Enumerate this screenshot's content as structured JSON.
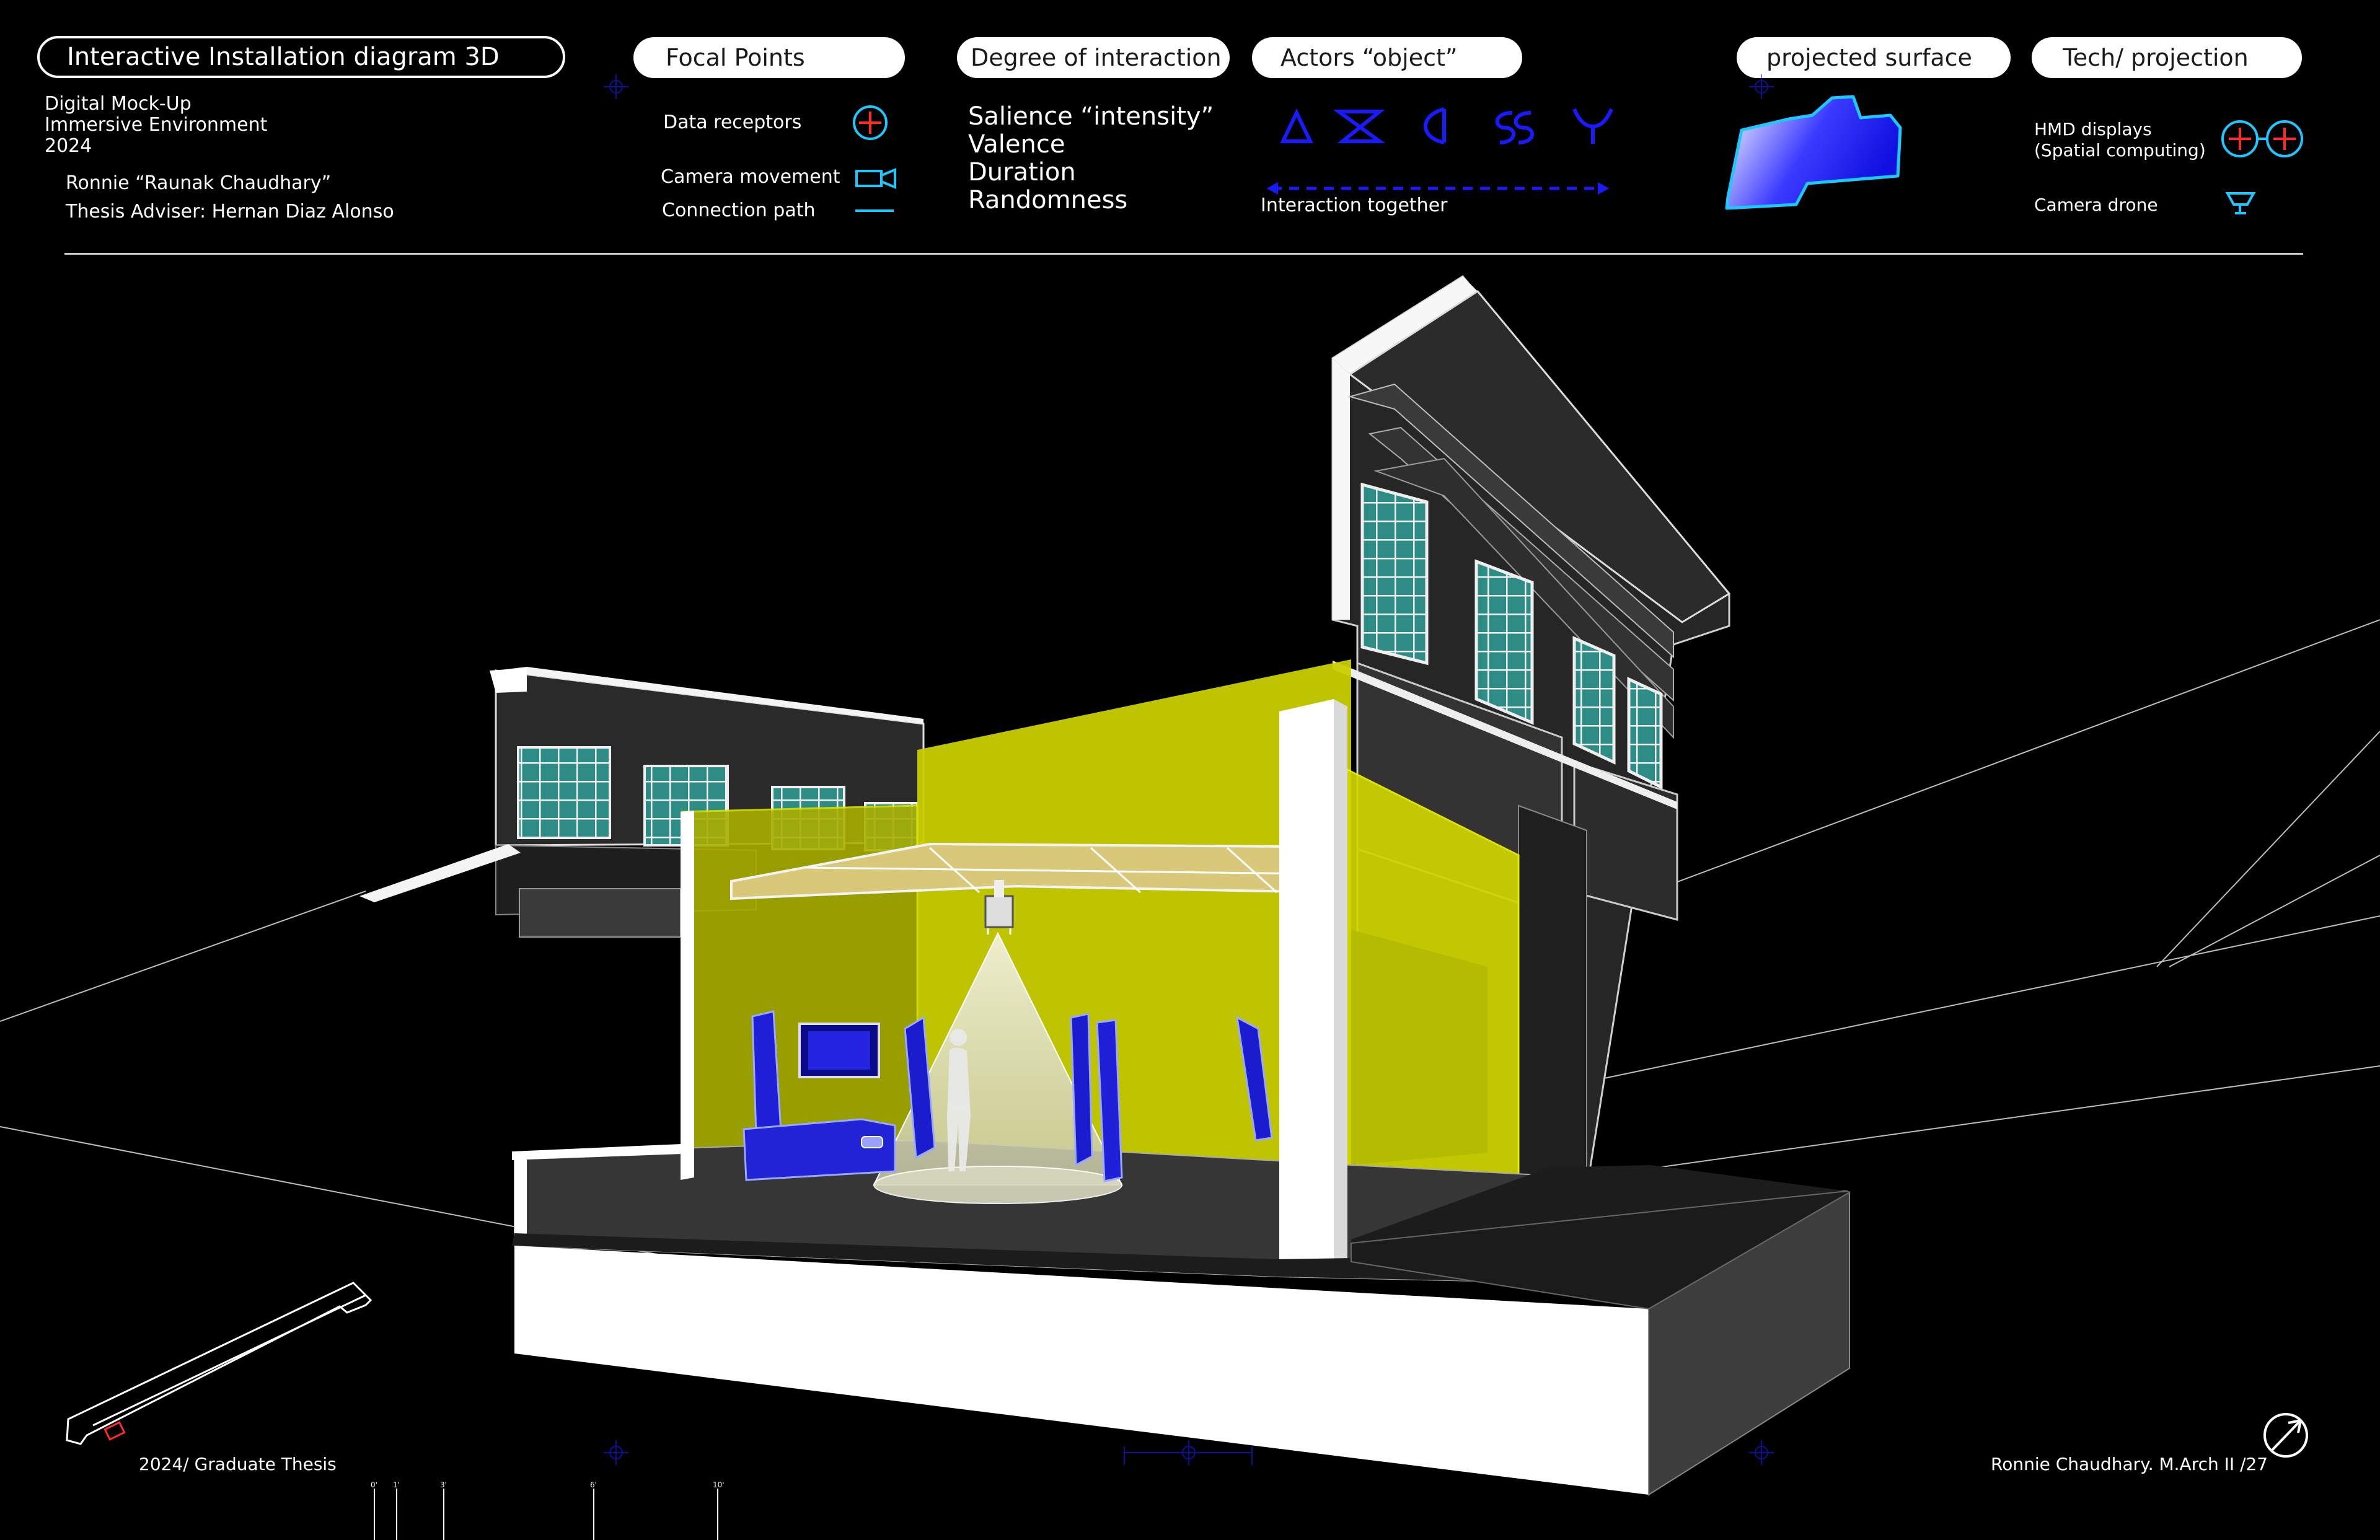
{
  "header": {
    "title": "Interactive Installation diagram 3D",
    "subtitle_lines": [
      "Digital Mock-Up",
      "Immersive Environment",
      "2024"
    ],
    "author": "Ronnie “Raunak Chaudhary”",
    "adviser": "Thesis Adviser: Hernan Diaz Alonso"
  },
  "legend": {
    "focal_points": {
      "label": "Focal Points",
      "items": [
        {
          "label": "Data receptors",
          "icon": "data-receptor-icon"
        },
        {
          "label": "Camera movement",
          "icon": "camera-movement-icon"
        },
        {
          "label": "Connection path",
          "icon": "connection-path-icon"
        }
      ]
    },
    "degree_of_interaction": {
      "label": "Degree of interaction",
      "items": [
        "Salience “intensity”",
        "Valence",
        "Duration",
        "Randomness"
      ]
    },
    "actors": {
      "label": "Actors “object”",
      "glyphs": [
        "triangle-glyph-icon",
        "hourglass-glyph-icon",
        "crescent-glyph-icon",
        "double-s-glyph-icon",
        "fork-glyph-icon"
      ],
      "note": "Interaction together"
    },
    "projected_surface": {
      "label": "projected surface"
    },
    "tech_projection": {
      "label": "Tech/ projection",
      "items": [
        {
          "label_lines": [
            "HMD displays",
            "(Spatial computing)"
          ],
          "icon": "hmd-glasses-icon"
        },
        {
          "label_lines": [
            "Camera drone"
          ],
          "icon": "camera-drone-icon"
        }
      ]
    }
  },
  "footer": {
    "left": "2024/ Graduate Thesis",
    "right": "Ronnie Chaudhary. M.Arch II /27",
    "scale_ticks": [
      "0'",
      "1'",
      "3'",
      "6'",
      "10'"
    ]
  },
  "colors": {
    "accent_blue": "#1a1aff",
    "cyan": "#1ec8ff",
    "yellow": "#d8e000",
    "red": "#ff2a2a",
    "glass": "#2f8f88"
  }
}
